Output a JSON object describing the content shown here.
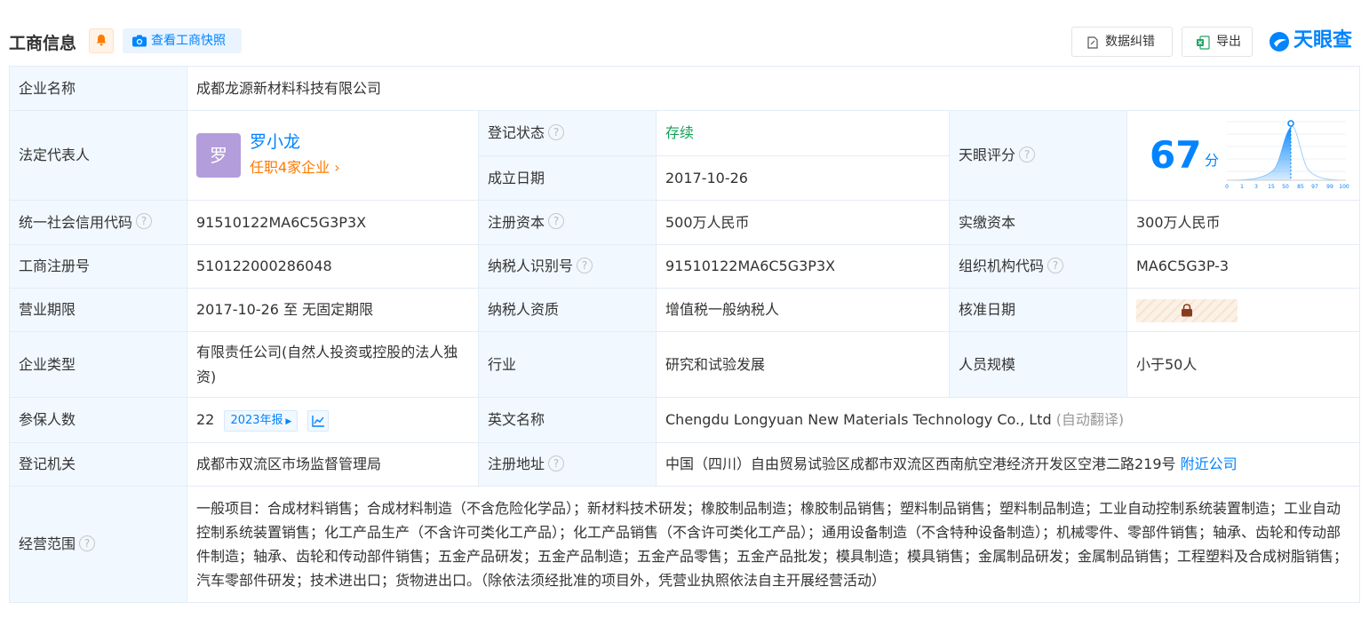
{
  "header": {
    "title": "工商信息",
    "snapshot_label": "查看工商快照",
    "correct_label": "数据纠错",
    "export_label": "导出",
    "logo_text": "天眼查"
  },
  "company": {
    "name_label": "企业名称",
    "name": "成都龙源新材料科技有限公司",
    "legal_rep_label": "法定代表人",
    "legal_rep_avatar": "罗",
    "legal_rep_name": "罗小龙",
    "legal_rep_jobs": "任职4家企业",
    "reg_status_label": "登记状态",
    "reg_status": "存续",
    "founded_label": "成立日期",
    "founded": "2017-10-26",
    "score_label": "天眼评分",
    "score": "67",
    "score_unit": "分",
    "score_ticks": [
      "0",
      "1",
      "3",
      "15",
      "50",
      "85",
      "97",
      "99",
      "100"
    ],
    "credit_code_label": "统一社会信用代码",
    "credit_code": "91510122MA6C5G3P3X",
    "reg_capital_label": "注册资本",
    "reg_capital": "500万人民币",
    "paid_capital_label": "实缴资本",
    "paid_capital": "300万人民币",
    "reg_no_label": "工商注册号",
    "reg_no": "510122000286048",
    "tax_id_label": "纳税人识别号",
    "tax_id": "91510122MA6C5G3P3X",
    "org_code_label": "组织机构代码",
    "org_code": "MA6C5G3P-3",
    "term_label": "营业期限",
    "term": "2017-10-26 至 无固定期限",
    "tax_qual_label": "纳税人资质",
    "tax_qual": "增值税一般纳税人",
    "approval_label": "核准日期",
    "type_label": "企业类型",
    "type": "有限责任公司(自然人投资或控股的法人独资)",
    "industry_label": "行业",
    "industry": "研究和试验发展",
    "staff_label": "人员规模",
    "staff": "小于50人",
    "insured_label": "参保人数",
    "insured": "22",
    "insured_year": "2023年报",
    "en_name_label": "英文名称",
    "en_name": "Chengdu Longyuan New Materials Technology Co., Ltd",
    "en_name_note": "(自动翻译)",
    "authority_label": "登记机关",
    "authority": "成都市双流区市场监督管理局",
    "address_label": "注册地址",
    "address": "中国（四川）自由贸易试验区成都市双流区西南航空港经济开发区空港二路219号",
    "nearby_label": "附近公司",
    "scope_label": "经营范围",
    "scope": "一般项目：合成材料销售；合成材料制造（不含危险化学品）；新材料技术研发；橡胶制品制造；橡胶制品销售；塑料制品销售；塑料制品制造；工业自动控制系统装置制造；工业自动控制系统装置销售；化工产品生产（不含许可类化工产品）；化工产品销售（不含许可类化工产品）；通用设备制造（不含特种设备制造）；机械零件、零部件销售；轴承、齿轮和传动部件制造；轴承、齿轮和传动部件销售；五金产品研发；五金产品制造；五金产品零售；五金产品批发；模具制造；模具销售；金属制品研发；金属制品销售；工程塑料及合成树脂销售；汽车零部件研发；技术进出口；货物进出口。（除依法须经批准的项目外，凭营业执照依法自主开展经营活动）"
  },
  "colors": {
    "accent": "#0084ff",
    "status_green": "#14a05a",
    "orange": "#ff7a00",
    "label_bg": "#f1f8ff"
  }
}
